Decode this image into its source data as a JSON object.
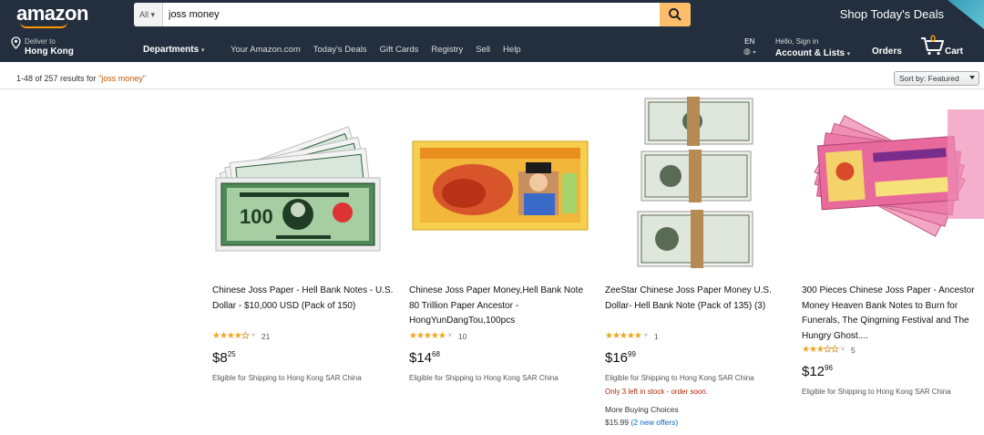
{
  "header": {
    "logo": "amazon",
    "search": {
      "scope": "All",
      "query": "joss money"
    },
    "promo": "Shop Today's Deals",
    "deliver_small": "Deliver to",
    "deliver_big": "Hong Kong",
    "departments": "Departments",
    "links": [
      "Your Amazon.com",
      "Today's Deals",
      "Gift Cards",
      "Registry",
      "Sell",
      "Help"
    ],
    "lang": "EN",
    "account_small": "Hello, Sign in",
    "account_big": "Account & Lists",
    "orders": "Orders",
    "cart_count": "0",
    "cart_label": "Cart"
  },
  "results": {
    "range": "1-48 of 257 results for ",
    "query": "\"joss money\""
  },
  "sort": {
    "label": "Sort by: Featured"
  },
  "products": [
    {
      "title": "Chinese Joss Paper - Hell Bank Notes - U.S. Dollar - $10,000 USD (Pack of 150)",
      "rating": 3.5,
      "reviews": "21",
      "price_whole": "$8",
      "price_frac": "25",
      "shipping": "Eligible for Shipping to Hong Kong SAR China"
    },
    {
      "title": "Chinese Joss Paper Money,Hell Bank Note 80 Trillion Paper Ancestor - HongYunDangTou,100pcs",
      "rating": 4.5,
      "reviews": "10",
      "price_whole": "$14",
      "price_frac": "68",
      "shipping": "Eligible for Shipping to Hong Kong SAR China"
    },
    {
      "title": "ZeeStar Chinese Joss Paper Money U.S. Dollar- Hell Bank Note (Pack of 135) (3)",
      "rating": 5,
      "reviews": "1",
      "price_whole": "$16",
      "price_frac": "99",
      "shipping": "Eligible for Shipping to Hong Kong SAR China",
      "stock": "Only 3 left in stock - order soon.",
      "more_label": "More Buying Choices",
      "offer_price": "$15.99",
      "offer_link": "(2 new offers)"
    },
    {
      "title": "300 Pieces Chinese Joss Paper - Ancestor Money Heaven Bank Notes to Burn for Funerals, The Qingming Festival and The Hungry Ghost....",
      "rating": 2.5,
      "reviews": "5",
      "price_whole": "$12",
      "price_frac": "96",
      "shipping": "Eligible for Shipping to Hong Kong SAR China"
    }
  ],
  "colors": {
    "nav_bg": "#232f3e",
    "search_button": "#febd69",
    "accent": "#ff9900",
    "star": "#f0a41c",
    "link": "#0066c0",
    "stock": "#b12704"
  }
}
